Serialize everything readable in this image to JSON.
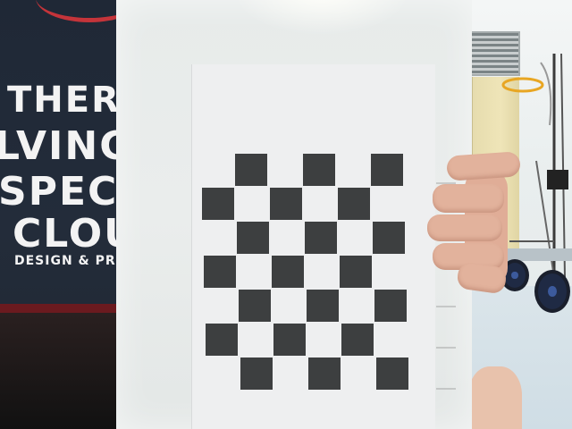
{
  "photo": {
    "shirt_print_lines": [
      "THERO",
      "LVING",
      "SPECI",
      "CLOU",
      "DESIGN & PRIN"
    ],
    "checkerboard": {
      "columns": 6,
      "rows": 7
    },
    "colors": {
      "shirt": "#1f2836",
      "collar_trim": "#c4343a",
      "checker_dark": "#3d3f40",
      "paper": "#eeeff0",
      "door": "#efe5b8",
      "skin": "#e2b29c"
    }
  }
}
